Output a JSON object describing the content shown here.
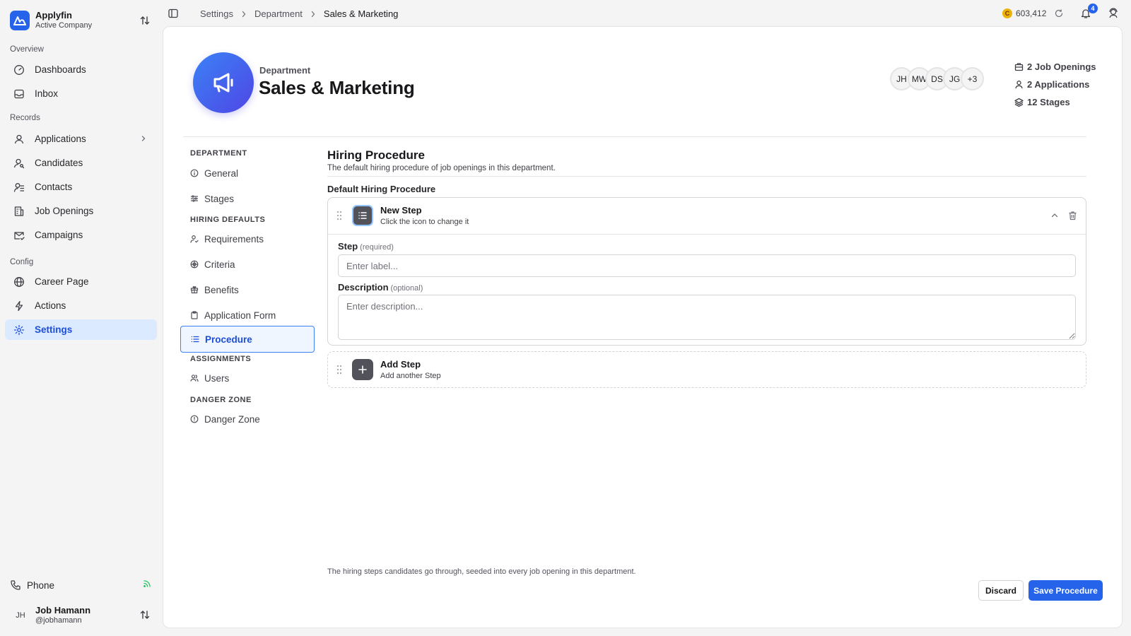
{
  "company": {
    "name": "Applyfin",
    "subtitle": "Active Company"
  },
  "sidebar": {
    "sections": {
      "overview": "Overview",
      "records": "Records",
      "config": "Config"
    },
    "items": {
      "dashboards": "Dashboards",
      "inbox": "Inbox",
      "applications": "Applications",
      "candidates": "Candidates",
      "contacts": "Contacts",
      "job_openings": "Job Openings",
      "campaigns": "Campaigns",
      "career_page": "Career Page",
      "actions": "Actions",
      "settings": "Settings"
    },
    "phone": "Phone",
    "user": {
      "initials": "JH",
      "name": "Job Hamann",
      "handle": "@jobhamann"
    }
  },
  "breadcrumb": [
    "Settings",
    "Department",
    "Sales & Marketing"
  ],
  "topbar": {
    "credits": "603,412",
    "coin_symbol": "C",
    "notifications": "4"
  },
  "department": {
    "label": "Department",
    "title": "Sales & Marketing",
    "members": [
      "JH",
      "MW",
      "DS",
      "JG",
      "+3"
    ],
    "stats": {
      "job_openings": "2 Job Openings",
      "applications": "2 Applications",
      "stages": "12 Stages"
    }
  },
  "subnav": {
    "sections": {
      "department": "DEPARTMENT",
      "hiring_defaults": "HIRING DEFAULTS",
      "assignments": "ASSIGNMENTS",
      "danger_zone": "DANGER ZONE"
    },
    "items": {
      "general": "General",
      "stages": "Stages",
      "requirements": "Requirements",
      "criteria": "Criteria",
      "benefits": "Benefits",
      "application_form": "Application Form",
      "procedure": "Procedure",
      "users": "Users",
      "danger_zone": "Danger Zone"
    }
  },
  "content": {
    "title": "Hiring Procedure",
    "description": "The default hiring procedure of job openings in this department.",
    "field_heading": "Default Hiring Procedure",
    "step": {
      "title": "New Step",
      "subtitle": "Click the icon to change it",
      "step_label": "Step",
      "step_hint": "(required)",
      "step_placeholder": "Enter label...",
      "desc_label": "Description",
      "desc_hint": "(optional)",
      "desc_placeholder": "Enter description..."
    },
    "add_step": {
      "title": "Add Step",
      "subtitle": "Add another Step"
    },
    "footer_note": "The hiring steps candidates go through, seeded into every job opening in this department.",
    "discard_label": "Discard",
    "save_label": "Save Procedure"
  },
  "colors": {
    "accent": "#2563eb",
    "active_bg": "#dbeafe",
    "success": "#22c55e",
    "coin": "#eab308"
  }
}
